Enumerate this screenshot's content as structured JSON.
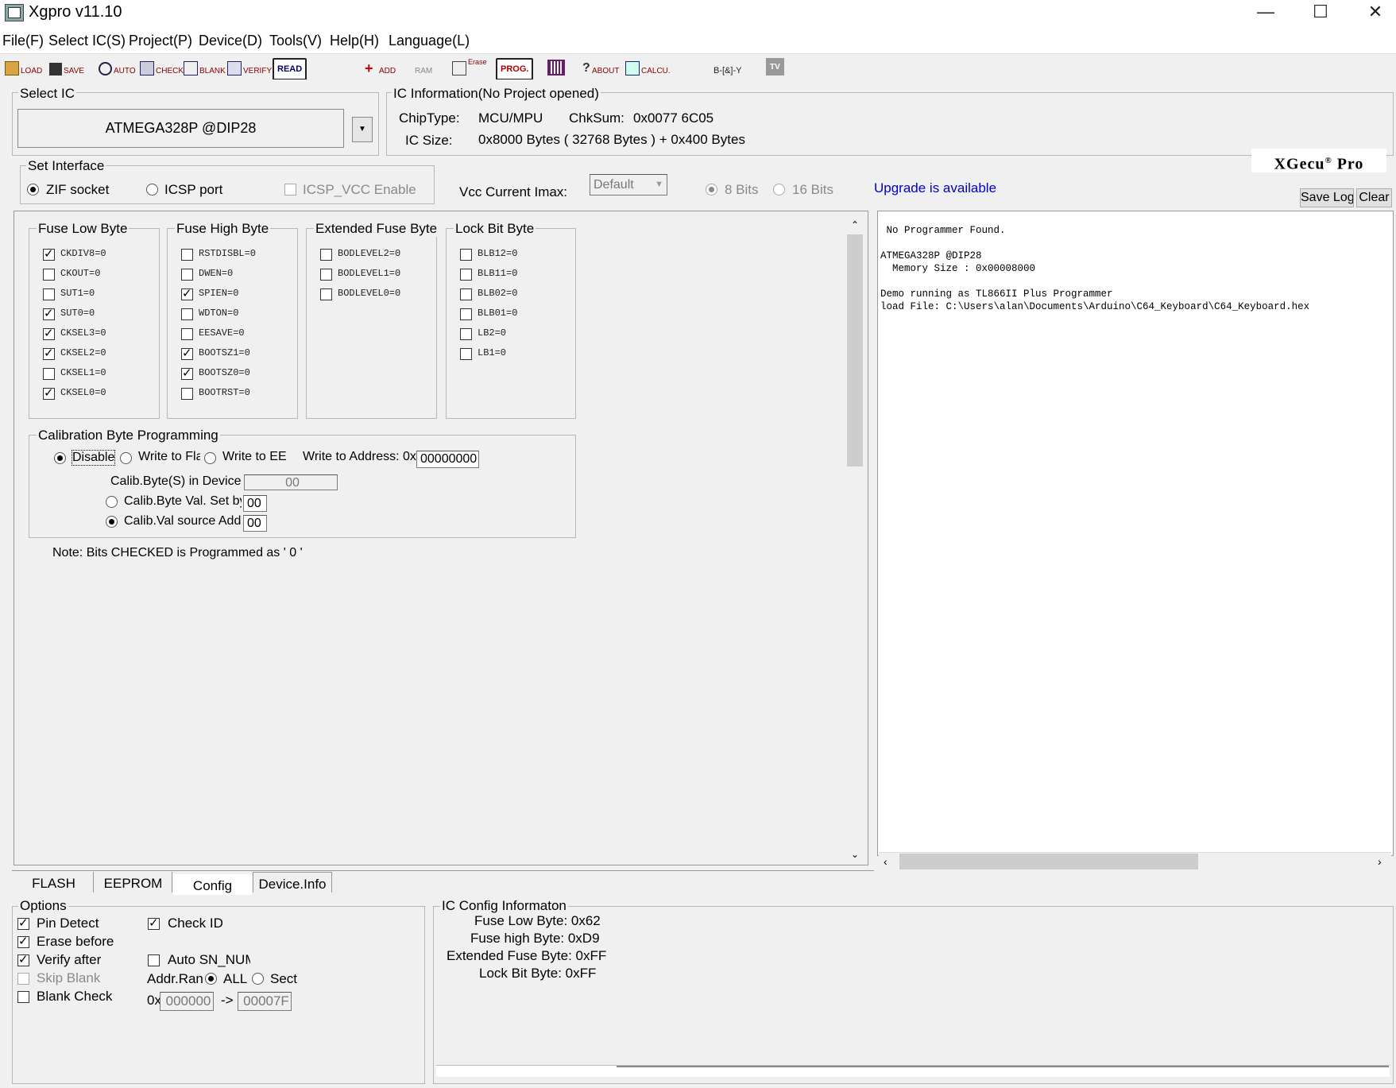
{
  "window": {
    "title": "Xgpro v11.10",
    "minimize_glyph": "—",
    "maximize_glyph": "☐",
    "close_glyph": "✕"
  },
  "menu": [
    "File(F)",
    "Select IC(S)",
    "Project(P)",
    "Device(D)",
    "Tools(V)",
    "Help(H)",
    "Language(L)"
  ],
  "toolbar": {
    "load": "LOAD",
    "save": "SAVE",
    "auto": "AUTO",
    "check": "CHECK",
    "blank": "BLANK",
    "verify": "VERIFY",
    "read": "READ",
    "add": "ADD",
    "ram": "RAM",
    "erase": "Erase",
    "prog": "PROG.",
    "about": "ABOUT",
    "calcu": "CALCU.",
    "logic": "B-[&]-Y",
    "tv": "TV"
  },
  "select_ic": {
    "legend": "Select IC",
    "value": "ATMEGA328P @DIP28"
  },
  "ic_info": {
    "legend": "IC Information(No Project opened)",
    "chip_type_label": "ChipType:",
    "chip_type": "MCU/MPU",
    "chksum_label": "ChkSum:",
    "chksum": "0x0077 6C05",
    "size_label": "IC Size:",
    "size": "0x8000 Bytes ( 32768 Bytes ) + 0x400 Bytes",
    "brand": "XGecu",
    "brand_reg": "®",
    "brand_suffix": "Pro"
  },
  "interface": {
    "legend": "Set Interface",
    "zif": "ZIF socket",
    "icsp": "ICSP port",
    "icsp_vcc": "ICSP_VCC Enable",
    "vcc_label": "Vcc Current Imax:",
    "vcc_value": "Default",
    "bits8": "8 Bits",
    "bits16": "16 Bits",
    "upgrade": "Upgrade is available",
    "save_log": "Save Log",
    "clear": "Clear"
  },
  "fuses": {
    "low": {
      "legend": "Fuse Low Byte",
      "items": [
        {
          "label": "CKDIV8=0",
          "checked": true
        },
        {
          "label": "CKOUT=0",
          "checked": false
        },
        {
          "label": "SUT1=0",
          "checked": false
        },
        {
          "label": "SUT0=0",
          "checked": true
        },
        {
          "label": "CKSEL3=0",
          "checked": true
        },
        {
          "label": "CKSEL2=0",
          "checked": true
        },
        {
          "label": "CKSEL1=0",
          "checked": false
        },
        {
          "label": "CKSEL0=0",
          "checked": true
        }
      ]
    },
    "high": {
      "legend": "Fuse High Byte",
      "items": [
        {
          "label": "RSTDISBL=0",
          "checked": false
        },
        {
          "label": "DWEN=0",
          "checked": false
        },
        {
          "label": "SPIEN=0",
          "checked": true
        },
        {
          "label": "WDTON=0",
          "checked": false
        },
        {
          "label": "EESAVE=0",
          "checked": false
        },
        {
          "label": "BOOTSZ1=0",
          "checked": true
        },
        {
          "label": "BOOTSZ0=0",
          "checked": true
        },
        {
          "label": "BOOTRST=0",
          "checked": false
        }
      ]
    },
    "ext": {
      "legend": "Extended Fuse Byte",
      "items": [
        {
          "label": "BODLEVEL2=0",
          "checked": false
        },
        {
          "label": "BODLEVEL1=0",
          "checked": false
        },
        {
          "label": "BODLEVEL0=0",
          "checked": false
        }
      ]
    },
    "lock": {
      "legend": "Lock Bit Byte",
      "items": [
        {
          "label": "BLB12=0",
          "checked": false
        },
        {
          "label": "BLB11=0",
          "checked": false
        },
        {
          "label": "BLB02=0",
          "checked": false
        },
        {
          "label": "BLB01=0",
          "checked": false
        },
        {
          "label": "LB2=0",
          "checked": false
        },
        {
          "label": "LB1=0",
          "checked": false
        }
      ]
    }
  },
  "calib": {
    "legend": "Calibration Byte Programming",
    "disable": "Disable",
    "write_fla": "Write to Fla",
    "write_ee": "Write to EE",
    "write_addr_label": "Write to Address: 0x",
    "write_addr": "00000000",
    "in_device_label": "Calib.Byte(S) in Device",
    "in_device": "00",
    "val_set_label": "Calib.Byte Val. Set by",
    "val_set": "00",
    "val_src_label": "Calib.Val source Add",
    "val_src": "00"
  },
  "note": "Note: Bits CHECKED is Programmed as ' 0 '",
  "log": [
    " No Programmer Found.",
    "",
    "ATMEGA328P @DIP28",
    "  Memory Size : 0x00008000",
    "",
    "Demo running as TL866II Plus Programmer",
    "load File: C:\\Users\\alan\\Documents\\Arduino\\C64_Keyboard\\C64_Keyboard.hex"
  ],
  "tabs": [
    "FLASH",
    "EEPROM",
    "Config",
    "Device.Info"
  ],
  "options": {
    "legend": "Options",
    "pin_detect": "Pin Detect",
    "erase_before": "Erase before",
    "verify_after": "Verify after",
    "skip_blank": "Skip Blank",
    "blank_check": "Blank Check",
    "check_id": "Check ID",
    "auto_sn": "Auto SN_NUM",
    "addr_range": "Addr.Ran",
    "all": "ALL",
    "sect": "Sect",
    "addr_prefix": "0x",
    "addr_from": "000000",
    "arrow": "->",
    "addr_to": "00007F"
  },
  "config_info": {
    "legend": "IC Config Informaton",
    "fuse_low": "Fuse Low Byte: 0x62",
    "fuse_high": "Fuse high Byte: 0xD9",
    "ext_fuse": "Extended Fuse Byte: 0xFF",
    "lock_bit": "Lock Bit Byte: 0xFF"
  }
}
